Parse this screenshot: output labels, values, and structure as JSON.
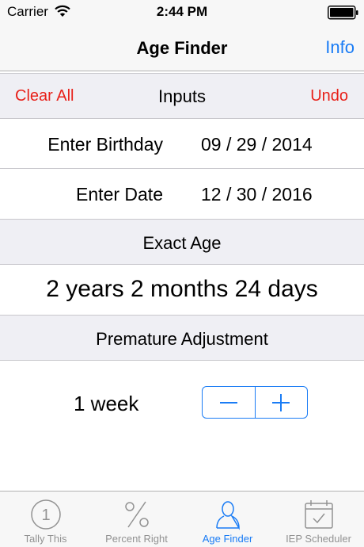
{
  "status_bar": {
    "carrier": "Carrier",
    "time": "2:44 PM"
  },
  "nav": {
    "title": "Age Finder",
    "info_label": "Info"
  },
  "inputs_section": {
    "clear_label": "Clear All",
    "title": "Inputs",
    "undo_label": "Undo"
  },
  "birthday": {
    "label": "Enter Birthday",
    "value": "09 / 29 / 2014"
  },
  "date": {
    "label": "Enter Date",
    "value": "12 / 30 / 2016"
  },
  "exact_age": {
    "title": "Exact Age",
    "result": "2 years 2 months 24 days"
  },
  "premature": {
    "title": "Premature Adjustment",
    "value": "1 week"
  },
  "tabs": [
    {
      "label": "Tally This",
      "icon": "tally-icon"
    },
    {
      "label": "Percent Right",
      "icon": "percent-icon"
    },
    {
      "label": "Age Finder",
      "icon": "person-icon"
    },
    {
      "label": "IEP Scheduler",
      "icon": "calendar-icon"
    }
  ],
  "colors": {
    "accent": "#1a7cf5",
    "destructive": "#e8211a",
    "tab_inactive": "#929292"
  }
}
